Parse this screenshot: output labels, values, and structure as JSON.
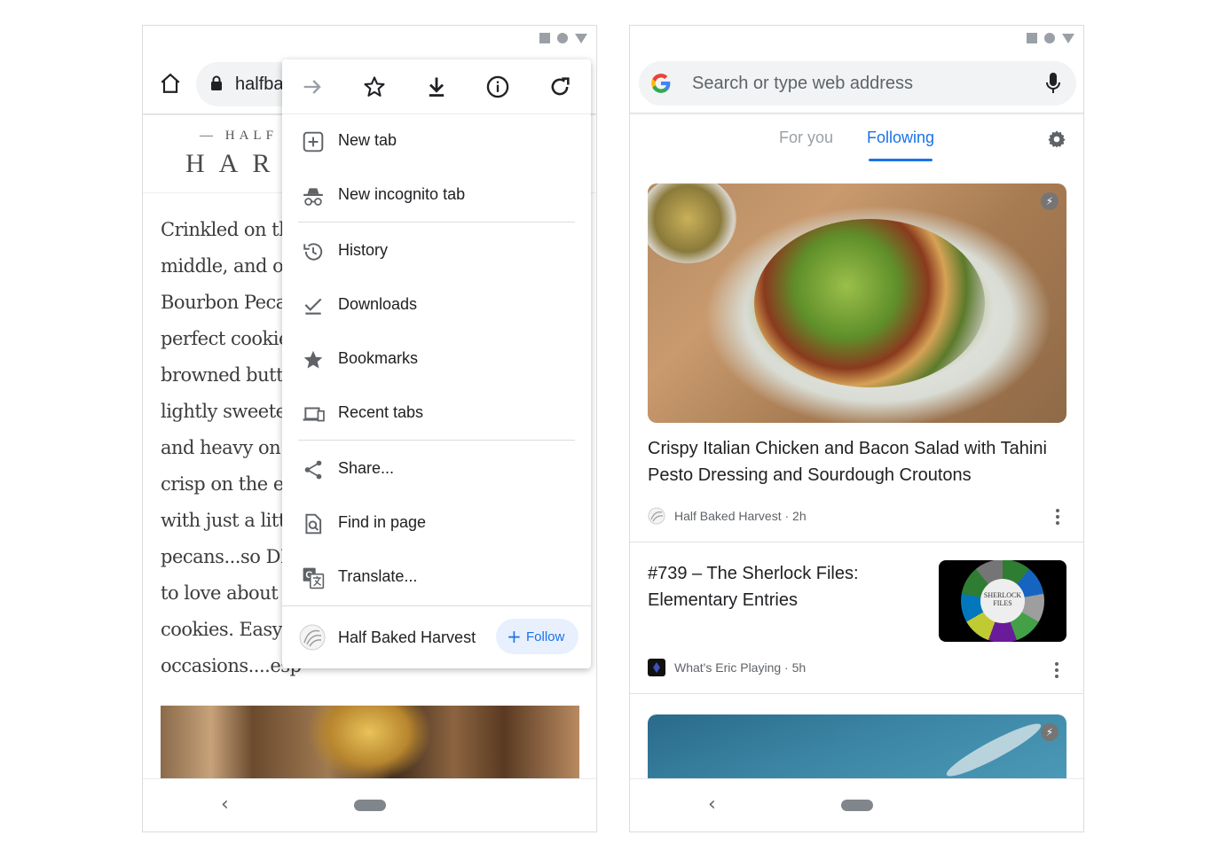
{
  "left_phone": {
    "url_text": "halfba",
    "logo_top": "— HALF",
    "logo_bottom": "HAR",
    "article_lines": [
      "Crinkled on th",
      "middle, and oh",
      "Bourbon Pecan",
      "perfect cookies",
      "browned butte",
      "lightly sweeten",
      "and heavy on t",
      "crisp on the ed",
      "with just a littl",
      "pecans...so DE",
      "to love about t",
      "cookies. Easy t",
      "occasions....esp"
    ],
    "menu": {
      "top_icons": [
        "forward-icon",
        "star-icon",
        "download-icon",
        "info-icon",
        "refresh-icon"
      ],
      "items": [
        {
          "label": "New tab",
          "icon": "new-tab-icon"
        },
        {
          "label": "New incognito tab",
          "icon": "incognito-icon"
        },
        {
          "label": "History",
          "icon": "history-icon"
        },
        {
          "label": "Downloads",
          "icon": "downloads-icon"
        },
        {
          "label": "Bookmarks",
          "icon": "bookmarks-icon"
        },
        {
          "label": "Recent tabs",
          "icon": "recent-tabs-icon"
        },
        {
          "label": "Share...",
          "icon": "share-icon"
        },
        {
          "label": "Find in page",
          "icon": "find-in-page-icon"
        },
        {
          "label": "Translate...",
          "icon": "translate-icon"
        }
      ],
      "footer": {
        "site_name": "Half Baked Harvest",
        "follow_label": "Follow"
      }
    }
  },
  "right_phone": {
    "search_placeholder": "Search or type web address",
    "tabs": [
      {
        "label": "For you",
        "active": false
      },
      {
        "label": "Following",
        "active": true
      }
    ],
    "accent_color": "#1a73e8",
    "cards": [
      {
        "title": "Crispy Italian Chicken and Bacon Salad with Tahini Pesto Dressing and Sourdough Croutons",
        "meta": "Half Baked Harvest · 2h"
      },
      {
        "title": "#739 – The Sherlock Files: Elementary Entries",
        "meta": "What's Eric Playing · 5h",
        "thumb_text": "SHERLOCK FILES"
      }
    ]
  }
}
